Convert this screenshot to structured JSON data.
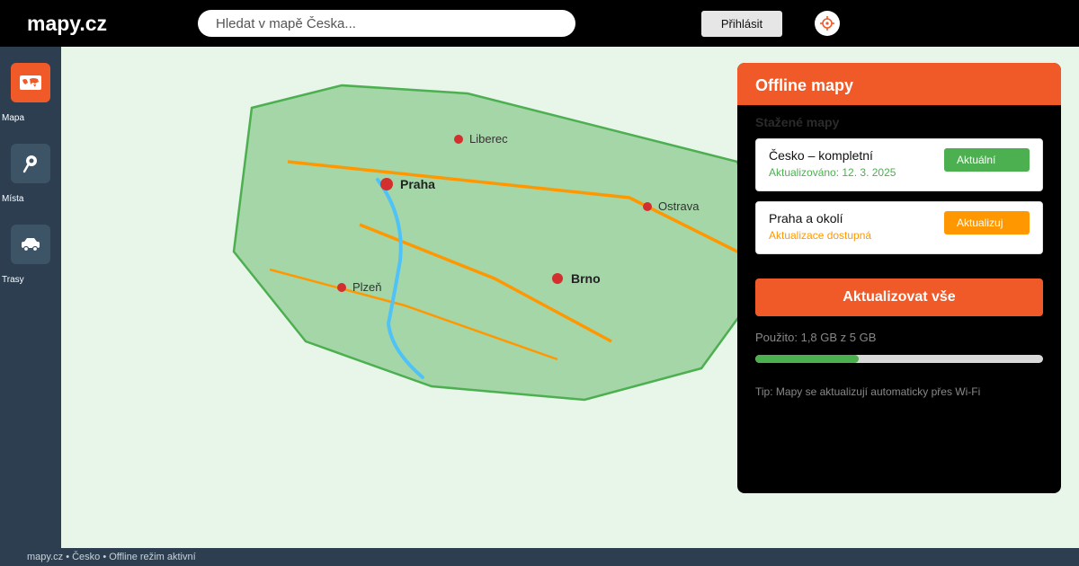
{
  "header": {
    "logo": "mapy.cz",
    "search_placeholder": "Hledat v mapě Česka...",
    "login_label": "Přihlásit",
    "locate_icon": "crosshair-icon"
  },
  "sidebar": {
    "items": [
      {
        "label": "Mapa",
        "icon": "world-map-icon",
        "active": true
      },
      {
        "label": "Místa",
        "icon": "pin-icon",
        "active": false
      },
      {
        "label": "Trasy",
        "icon": "car-icon",
        "active": false
      }
    ]
  },
  "map": {
    "cities": [
      "Liberec",
      "Praha",
      "Ostrava",
      "Plzeň",
      "Brno"
    ]
  },
  "panel": {
    "title": "Offline mapy",
    "subtitle": "Stažené mapy",
    "maps": [
      {
        "name": "Česko – kompletní",
        "status": "Aktualizováno: 12. 3. 2025",
        "status_color": "#4caf50",
        "badge": "Aktuální",
        "badge_color": "#4caf50"
      },
      {
        "name": "Praha a okolí",
        "status": "Aktualizace dostupná",
        "status_color": "#ff9800",
        "badge": "Aktualizuj",
        "badge_color": "#ff9800"
      }
    ],
    "update_all_label": "Aktualizovat vše",
    "usage_text": "Použito: 1,8 GB z 5 GB",
    "usage_fraction": 0.36,
    "tip": "Tip: Mapy se aktualizují automaticky přes Wi-Fi"
  },
  "footer": {
    "text": "mapy.cz • Česko • Offline režim aktivní"
  },
  "colors": {
    "accent": "#f05a28",
    "sidebar": "#2c3e50",
    "country_fill": "#a5d6a7",
    "country_border": "#4caf50",
    "road": "#ff9800",
    "river": "#4fc3f7",
    "city": "#d32f2f"
  }
}
